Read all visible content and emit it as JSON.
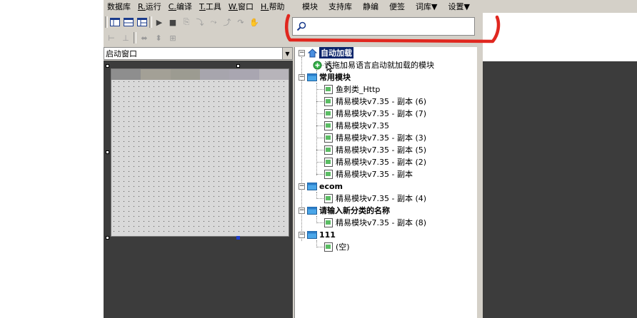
{
  "menu": {
    "items": [
      {
        "key": "",
        "label": "数据库"
      },
      {
        "key": "R.",
        "label": "运行"
      },
      {
        "key": "C.",
        "label": "编译"
      },
      {
        "key": "T.",
        "label": "工具"
      },
      {
        "key": "W.",
        "label": "窗口"
      },
      {
        "key": "H.",
        "label": "帮助"
      }
    ],
    "right_items": [
      "模块",
      "支持库",
      "静编",
      "便签",
      "词库▼",
      "设置▼"
    ]
  },
  "search": {
    "value": "",
    "placeholder": ""
  },
  "window_combo": {
    "value": "启动窗口"
  },
  "colors": {
    "highlight_ring": "#e0271f",
    "selection": "#0a246a"
  },
  "tree": {
    "groups": [
      {
        "label": "自动加载",
        "children": [
          "请拖加易语言启动就加载的模块"
        ]
      },
      {
        "label": "常用模块",
        "children": [
          "鱼刺类_Http",
          "精易模块v7.35 - 副本 (6)",
          "精易模块v7.35 - 副本 (7)",
          "精易模块v7.35",
          "精易模块v7.35 - 副本 (3)",
          "精易模块v7.35 - 副本 (5)",
          "精易模块v7.35 - 副本 (2)",
          "精易模块v7.35 - 副本"
        ]
      },
      {
        "label": "ecom",
        "children": [
          "精易模块v7.35 - 副本 (4)"
        ]
      },
      {
        "label": "请输入新分类的名称",
        "children": [
          "精易模块v7.35 - 副本 (8)"
        ]
      },
      {
        "label": "111",
        "children": [
          "(空)"
        ]
      }
    ]
  }
}
